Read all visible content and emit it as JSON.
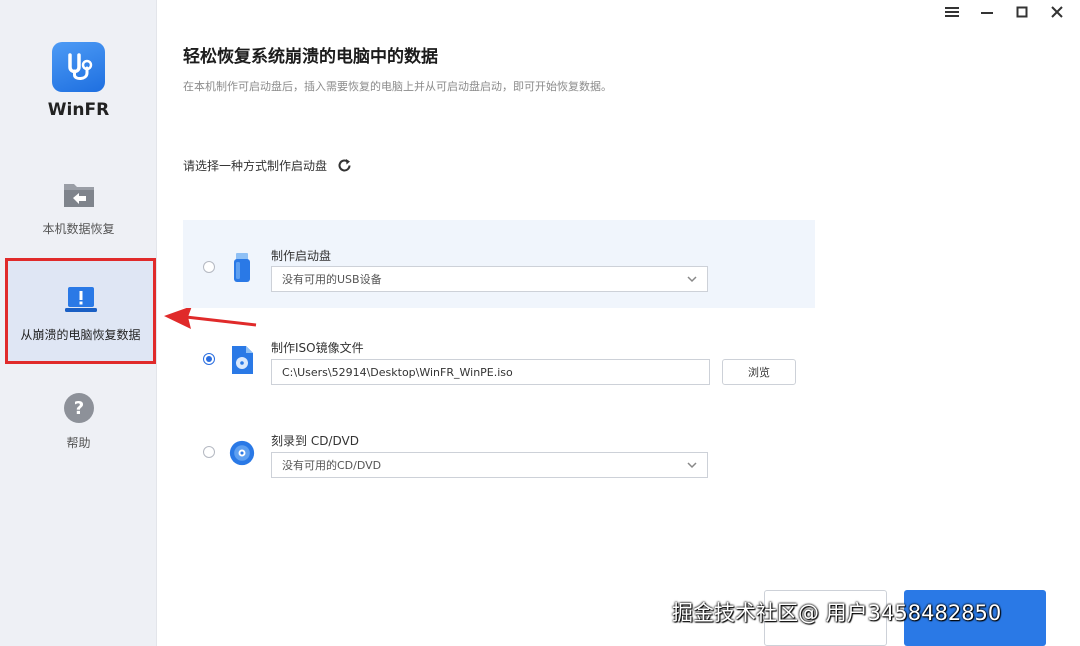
{
  "app": {
    "name": "WinFR",
    "logo_icon": "stethoscope-icon"
  },
  "window_controls": [
    "menu-icon",
    "minimize-icon",
    "maximize-icon",
    "close-icon"
  ],
  "sidebar": {
    "items": [
      {
        "label": "本机数据恢复",
        "icon": "folder-back-icon",
        "active": false
      },
      {
        "label": "从崩溃的电脑恢复数据",
        "icon": "laptop-alert-icon",
        "active": true
      },
      {
        "label": "帮助",
        "icon": "help-icon",
        "active": false
      }
    ]
  },
  "main": {
    "title": "轻松恢复系统崩溃的电脑中的数据",
    "subtitle": "在本机制作可启动盘后，插入需要恢复的电脑上并从可启动盘启动，即可开始恢复数据。",
    "section_label": "请选择一种方式制作启动盘",
    "options": [
      {
        "title": "制作启动盘",
        "value": "没有可用的USB设备",
        "icon": "usb-drive-icon",
        "selected": false
      },
      {
        "title": "制作ISO镜像文件",
        "value": "C:\\Users\\52914\\Desktop\\WinFR_WinPE.iso",
        "icon": "iso-file-icon",
        "selected": true,
        "browse_label": "浏览"
      },
      {
        "title": "刻录到 CD/DVD",
        "value": "没有可用的CD/DVD",
        "icon": "cd-disc-icon",
        "selected": false
      }
    ]
  },
  "watermark": "掘金技术社区@ 用户3458482850",
  "colors": {
    "accent": "#2a79e6",
    "highlight_border": "#e02a2a",
    "sidebar_bg": "#eef0f5"
  }
}
